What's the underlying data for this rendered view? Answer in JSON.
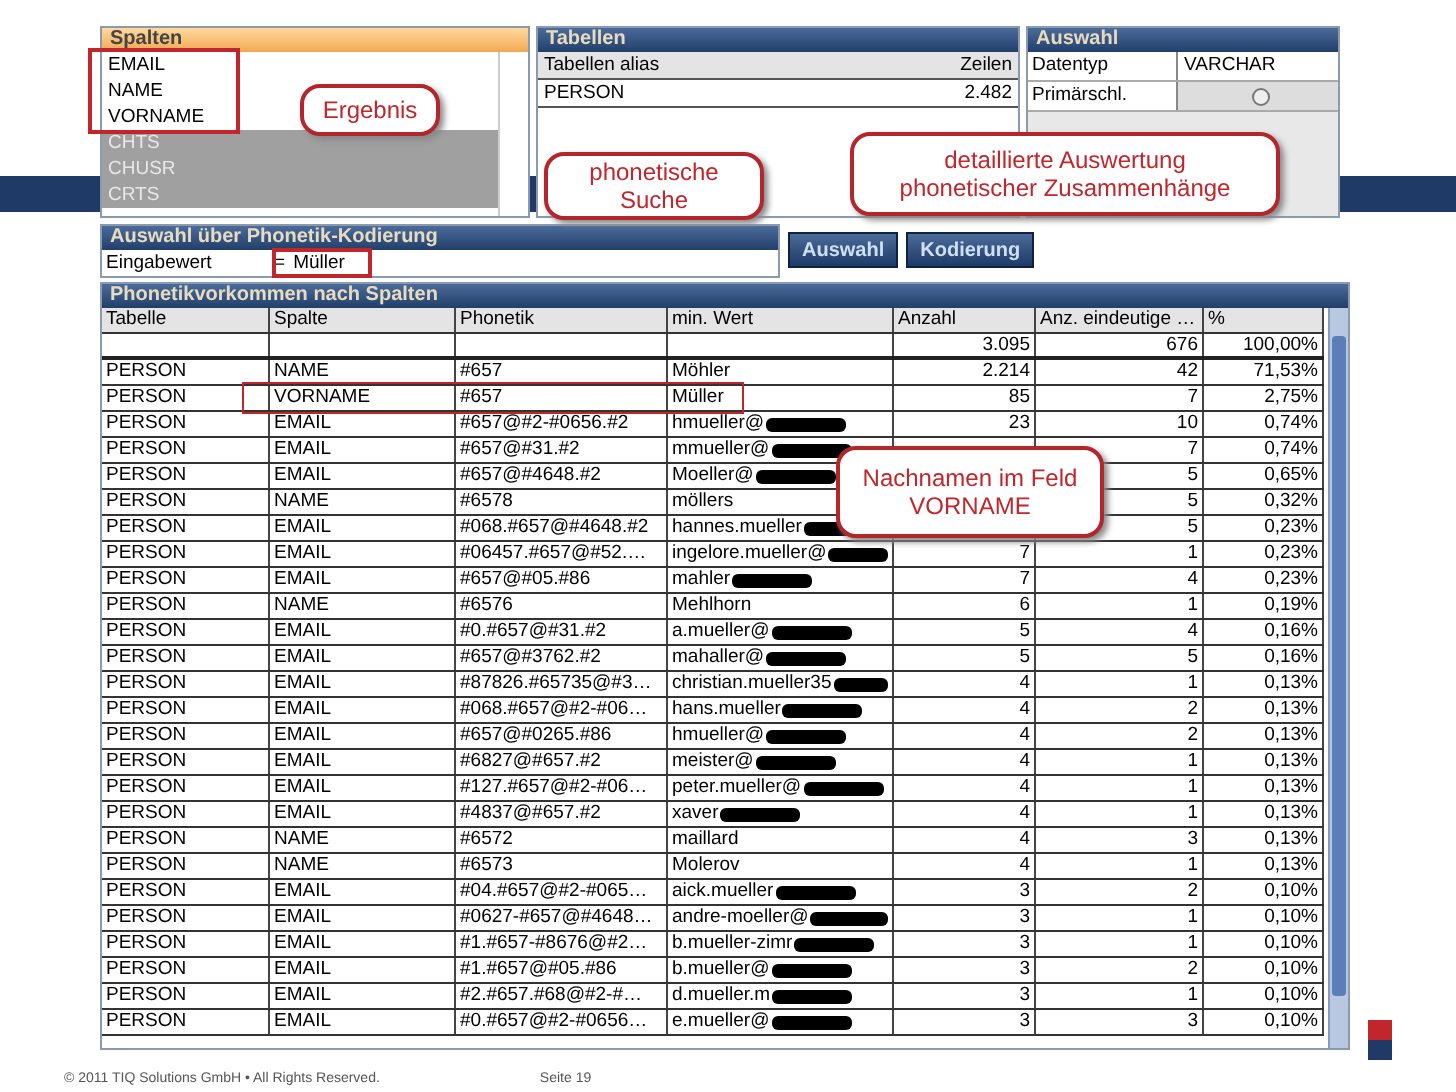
{
  "spalten": {
    "title": "Spalten",
    "items": [
      {
        "label": "EMAIL",
        "selected": true
      },
      {
        "label": "NAME",
        "selected": true
      },
      {
        "label": "VORNAME",
        "selected": true
      },
      {
        "label": "CHTS",
        "selected": false
      },
      {
        "label": "CHUSR",
        "selected": false
      },
      {
        "label": "CRTS",
        "selected": false
      }
    ]
  },
  "tabellen": {
    "title": "Tabellen",
    "columns": [
      "Tabellen alias",
      "Zeilen"
    ],
    "rows": [
      [
        "PERSON",
        "2.482"
      ]
    ]
  },
  "auswahl": {
    "title": "Auswahl",
    "rows": [
      {
        "label": "Datentyp",
        "kind": "text",
        "value": "VARCHAR"
      },
      {
        "label": "Primärschl.",
        "kind": "radio"
      }
    ]
  },
  "eingabe": {
    "title": "Auswahl über Phonetik-Kodierung",
    "label": "Eingabewert",
    "operator": "=",
    "value": "Müller"
  },
  "buttons": [
    "Auswahl",
    "Kodierung"
  ],
  "table": {
    "title": "Phonetikvorkommen nach Spalten",
    "columns": [
      "Tabelle",
      "Spalte",
      "Phonetik",
      "min. Wert",
      "Anzahl",
      "Anz. eindeutige …",
      "%"
    ],
    "total": {
      "anzahl": "3.095",
      "eindeutig": "676",
      "percent": "100,00%"
    },
    "rows": [
      {
        "cells": [
          "PERSON",
          "NAME",
          "#657",
          "Möhler",
          "2.214",
          "42",
          "71,53%"
        ],
        "redacted": false
      },
      {
        "cells": [
          "PERSON",
          "VORNAME",
          "#657",
          "Müller",
          "85",
          "7",
          "2,75%"
        ],
        "redacted": false
      },
      {
        "cells": [
          "PERSON",
          "EMAIL",
          "#657@#2-#0656.#2",
          "hmueller@",
          "23",
          "10",
          "0,74%"
        ],
        "redacted": true
      },
      {
        "cells": [
          "PERSON",
          "EMAIL",
          "#657@#31.#2",
          "mmueller@",
          "",
          "7",
          "0,74%"
        ],
        "redacted": true
      },
      {
        "cells": [
          "PERSON",
          "EMAIL",
          "#657@#4648.#2",
          "Moeller@",
          "",
          "5",
          "0,65%"
        ],
        "redacted": true
      },
      {
        "cells": [
          "PERSON",
          "NAME",
          "#6578",
          "möllers",
          "",
          "5",
          "0,32%"
        ],
        "redacted": false
      },
      {
        "cells": [
          "PERSON",
          "EMAIL",
          "#068.#657@#4648.#2",
          "hannes.mueller",
          "",
          "5",
          "0,23%"
        ],
        "redacted": true
      },
      {
        "cells": [
          "PERSON",
          "EMAIL",
          "#06457.#657@#52.…",
          "ingelore.mueller@",
          "7",
          "1",
          "0,23%"
        ],
        "redacted": true
      },
      {
        "cells": [
          "PERSON",
          "EMAIL",
          "#657@#05.#86",
          "mahler",
          "7",
          "4",
          "0,23%"
        ],
        "redacted": true
      },
      {
        "cells": [
          "PERSON",
          "NAME",
          "#6576",
          "Mehlhorn",
          "6",
          "1",
          "0,19%"
        ],
        "redacted": false
      },
      {
        "cells": [
          "PERSON",
          "EMAIL",
          "#0.#657@#31.#2",
          "a.mueller@",
          "5",
          "4",
          "0,16%"
        ],
        "redacted": true
      },
      {
        "cells": [
          "PERSON",
          "EMAIL",
          "#657@#3762.#2",
          "mahaller@",
          "5",
          "5",
          "0,16%"
        ],
        "redacted": true
      },
      {
        "cells": [
          "PERSON",
          "EMAIL",
          "#87826.#65735@#3…",
          "christian.mueller35",
          "4",
          "1",
          "0,13%"
        ],
        "redacted": true
      },
      {
        "cells": [
          "PERSON",
          "EMAIL",
          "#068.#657@#2-#06…",
          "hans.mueller",
          "4",
          "2",
          "0,13%"
        ],
        "redacted": true
      },
      {
        "cells": [
          "PERSON",
          "EMAIL",
          "#657@#0265.#86",
          "hmueller@",
          "4",
          "2",
          "0,13%"
        ],
        "redacted": true
      },
      {
        "cells": [
          "PERSON",
          "EMAIL",
          "#6827@#657.#2",
          "meister@",
          "4",
          "1",
          "0,13%"
        ],
        "redacted": true
      },
      {
        "cells": [
          "PERSON",
          "EMAIL",
          "#127.#657@#2-#06…",
          "peter.mueller@",
          "4",
          "1",
          "0,13%"
        ],
        "redacted": true
      },
      {
        "cells": [
          "PERSON",
          "EMAIL",
          "#4837@#657.#2",
          "xaver",
          "4",
          "1",
          "0,13%"
        ],
        "redacted": true
      },
      {
        "cells": [
          "PERSON",
          "NAME",
          "#6572",
          "maillard",
          "4",
          "3",
          "0,13%"
        ],
        "redacted": false
      },
      {
        "cells": [
          "PERSON",
          "NAME",
          "#6573",
          "Molerov",
          "4",
          "1",
          "0,13%"
        ],
        "redacted": false
      },
      {
        "cells": [
          "PERSON",
          "EMAIL",
          "#04.#657@#2-#065…",
          "aick.mueller",
          "3",
          "2",
          "0,10%"
        ],
        "redacted": true
      },
      {
        "cells": [
          "PERSON",
          "EMAIL",
          "#0627-#657@#4648…",
          "andre-moeller@",
          "3",
          "1",
          "0,10%"
        ],
        "redacted": true
      },
      {
        "cells": [
          "PERSON",
          "EMAIL",
          "#1.#657-#8676@#2…",
          "b.mueller-zimr",
          "3",
          "1",
          "0,10%"
        ],
        "redacted": true
      },
      {
        "cells": [
          "PERSON",
          "EMAIL",
          "#1.#657@#05.#86",
          "b.mueller@",
          "3",
          "2",
          "0,10%"
        ],
        "redacted": true
      },
      {
        "cells": [
          "PERSON",
          "EMAIL",
          "#2.#657.#68@#2-#…",
          "d.mueller.m",
          "3",
          "1",
          "0,10%"
        ],
        "redacted": true
      },
      {
        "cells": [
          "PERSON",
          "EMAIL",
          "#0.#657@#2-#0656…",
          "e.mueller@",
          "3",
          "3",
          "0,10%"
        ],
        "redacted": true
      }
    ]
  },
  "callouts": [
    "Ergebnis",
    "phonetische Suche",
    "detaillierte Auswertung phonetischer Zusammenhänge",
    "Nachnamen im Feld VORNAME"
  ],
  "footer": {
    "copyright": "© 2011 TIQ Solutions GmbH  •  All Rights Reserved.",
    "page": "Seite 19"
  }
}
